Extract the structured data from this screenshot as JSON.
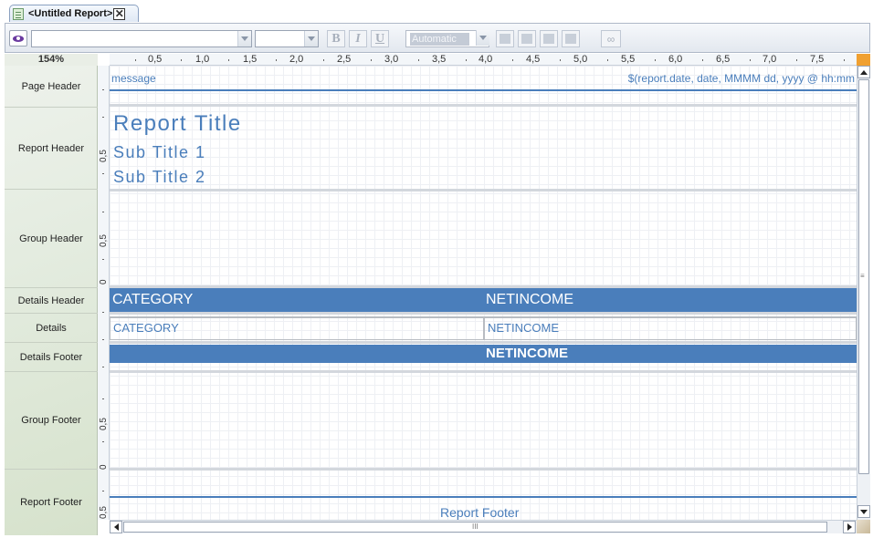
{
  "tab": {
    "title": "<Untitled Report>",
    "close_glyph": "✕"
  },
  "toolbar": {
    "eye_icon": "eye-icon",
    "font_combo_value": "",
    "size_combo_value": "",
    "bold_label": "B",
    "italic_label": "I",
    "underline_label": "U",
    "color_value": "Automatic",
    "link_glyph": "∞"
  },
  "zoom": "154%",
  "bands": [
    "Page Header",
    "Report Header",
    "Group Header",
    "Details Header",
    "Details",
    "Details Footer",
    "Group Footer",
    "Report Footer"
  ],
  "hruler": [
    "0,5",
    "1,0",
    "1,5",
    "2,0",
    "2,5",
    "3,0",
    "3,5",
    "4,0",
    "4,5",
    "5,0",
    "5,5",
    "6,0",
    "6,5",
    "7,0",
    "7,5"
  ],
  "vruler_label": "0,5",
  "vruler_zero": "0",
  "canvas": {
    "page_header_left": "message",
    "page_header_right": "$(report.date, date, MMMM dd, yyyy @ hh:mm",
    "report_title": "Report Title",
    "sub_title_1": "Sub Title 1",
    "sub_title_2": "Sub Title 2",
    "details_header_col1": "CATEGORY",
    "details_header_col2": "NETINCOME",
    "details_col1": "CATEGORY",
    "details_col2": "NETINCOME",
    "details_footer_col2": "NETINCOME",
    "report_footer": "Report Footer"
  },
  "scroll_grip": "III",
  "colors": {
    "accent": "#4a7ebb",
    "band_bg": "#e4ece0",
    "grid": "#eef0f4"
  }
}
